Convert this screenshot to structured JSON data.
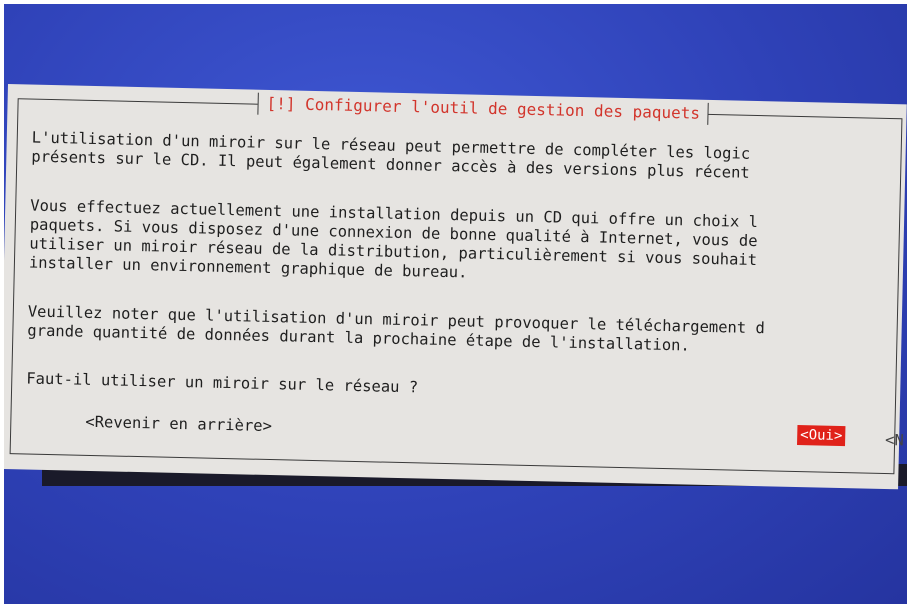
{
  "dialog": {
    "title": "[!] Configurer l'outil de gestion des paquets",
    "paragraphs": [
      "L'utilisation d'un miroir sur le réseau peut permettre de compléter les logic\nprésents sur le CD. Il peut également donner accès à des versions plus récent",
      "Vous effectuez actuellement une installation depuis un CD qui offre un choix l\npaquets. Si vous disposez d'une connexion de bonne qualité à Internet, vous de\nutiliser un miroir réseau de la distribution, particulièrement si vous souhait\ninstaller un environnement graphique de bureau.",
      "Veuillez noter que l'utilisation d'un miroir peut provoquer le téléchargement d\ngrande quantité de données durant la prochaine étape de l'installation."
    ],
    "question": "Faut-il utiliser un miroir sur le réseau ?",
    "buttons": {
      "back": "<Revenir en arrière>",
      "yes": "<Oui>",
      "no": "<N"
    }
  },
  "colors": {
    "screen_background": "#2f42b8",
    "dialog_background": "#e6e4e1",
    "title_text": "#d2352c",
    "selected_button": "#e0221a"
  }
}
